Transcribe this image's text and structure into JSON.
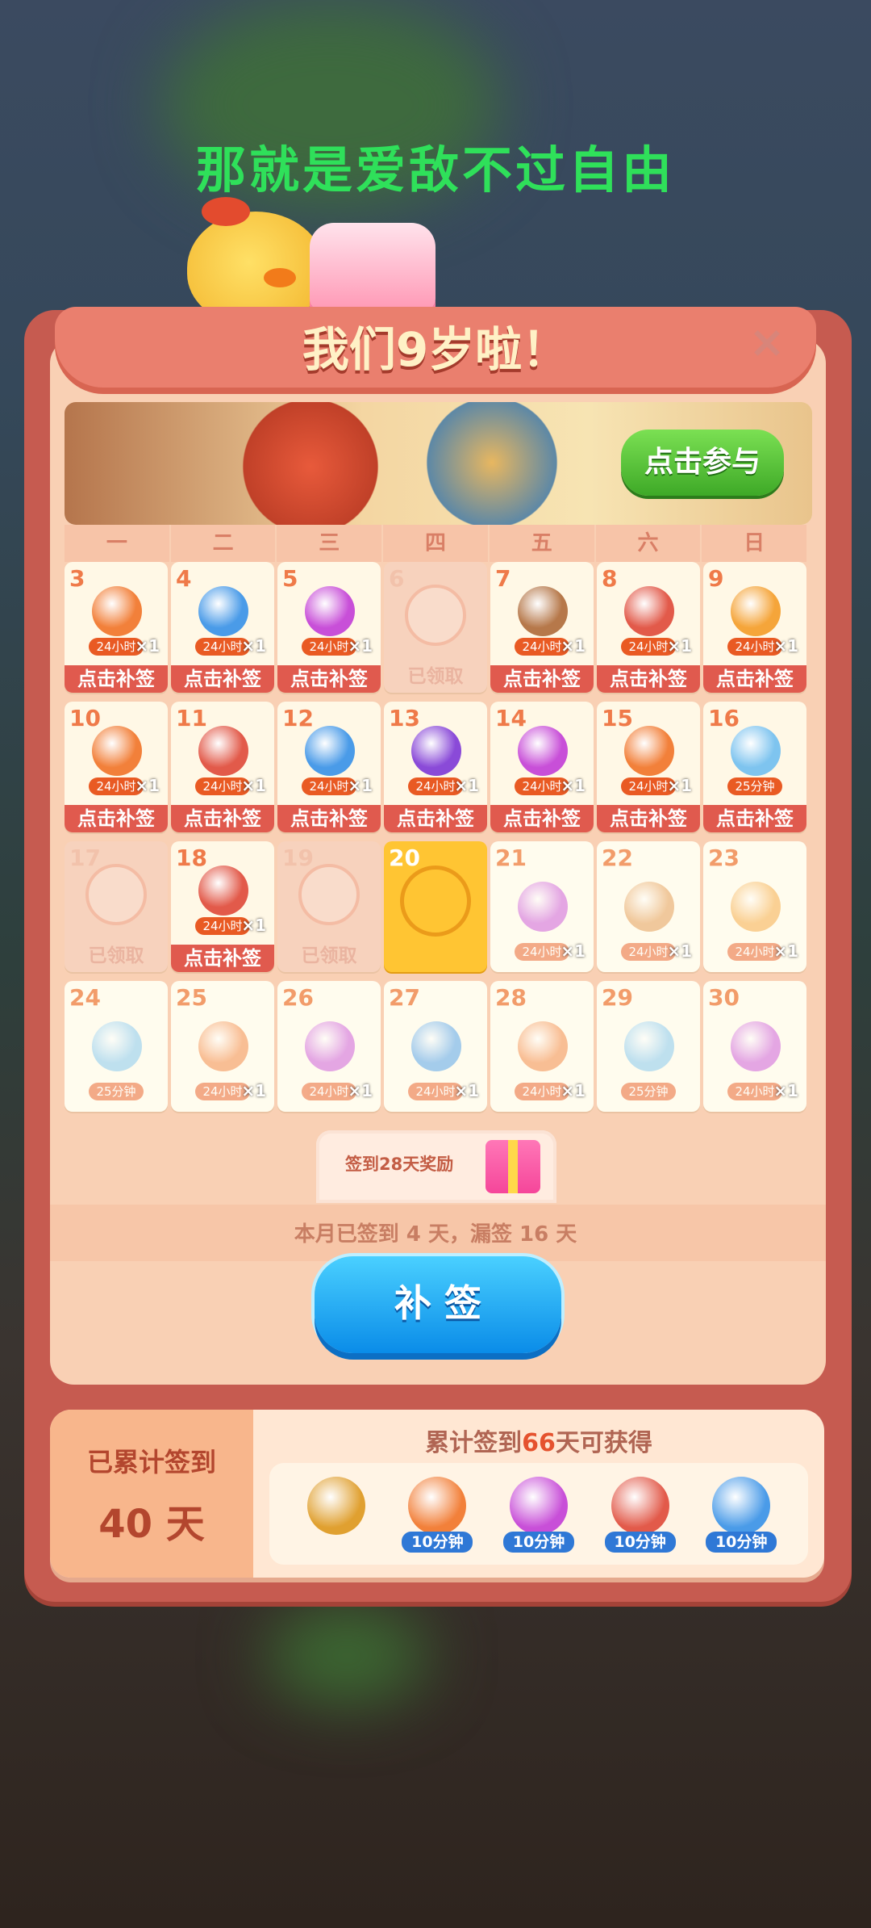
{
  "caption": "那就是爱敌不过自由",
  "title": "我们9岁啦！",
  "close_icon": "×",
  "banner": {
    "join_label": "点击参与"
  },
  "weekdays": [
    "一",
    "二",
    "三",
    "四",
    "五",
    "六",
    "日"
  ],
  "days": [
    {
      "n": "3",
      "icon": "plus3-icon",
      "tag": "24小时",
      "qty": "×1",
      "foot": "点击补签",
      "state": "missed",
      "color": "#f2803a"
    },
    {
      "n": "4",
      "icon": "blue-bird-icon",
      "tag": "24小时",
      "qty": "×1",
      "foot": "点击补签",
      "state": "missed",
      "color": "#4a9be8"
    },
    {
      "n": "5",
      "icon": "rainbow-owl-icon",
      "tag": "24小时",
      "qty": "×1",
      "foot": "点击补签",
      "state": "missed",
      "color": "#c84fd8"
    },
    {
      "n": "6",
      "icon": "paw-icon",
      "foot": "已领取",
      "state": "claimed"
    },
    {
      "n": "7",
      "icon": "hammer-icon",
      "tag": "24小时",
      "qty": "×1",
      "foot": "点击补签",
      "state": "missed",
      "color": "#b6784a"
    },
    {
      "n": "8",
      "icon": "rocket-icon",
      "tag": "24小时",
      "qty": "×1",
      "foot": "点击补签",
      "state": "missed",
      "color": "#e25a4a"
    },
    {
      "n": "9",
      "icon": "clock-icon",
      "tag": "24小时",
      "qty": "×1",
      "foot": "点击补签",
      "state": "missed",
      "color": "#f5a53a"
    },
    {
      "n": "10",
      "icon": "plus3-icon",
      "tag": "24小时",
      "qty": "×1",
      "foot": "点击补签",
      "state": "missed",
      "color": "#f2803a"
    },
    {
      "n": "11",
      "icon": "rocket-icon",
      "tag": "24小时",
      "qty": "×1",
      "foot": "点击补签",
      "state": "missed",
      "color": "#e25a4a"
    },
    {
      "n": "12",
      "icon": "blue-bird-icon",
      "tag": "24小时",
      "qty": "×1",
      "foot": "点击补签",
      "state": "missed",
      "color": "#4a9be8"
    },
    {
      "n": "13",
      "icon": "purple-bird-icon",
      "tag": "24小时",
      "qty": "×1",
      "foot": "点击补签",
      "state": "missed",
      "color": "#8a4ad8"
    },
    {
      "n": "14",
      "icon": "rainbow-owl-icon",
      "tag": "24小时",
      "qty": "×1",
      "foot": "点击补签",
      "state": "missed",
      "color": "#c84fd8"
    },
    {
      "n": "15",
      "icon": "plus3-icon",
      "tag": "24小时",
      "qty": "×1",
      "foot": "点击补签",
      "state": "missed",
      "color": "#f2803a"
    },
    {
      "n": "16",
      "icon": "bottle-icon",
      "tag": "25分钟",
      "qty": "",
      "foot": "点击补签",
      "state": "missed",
      "color": "#7ec4ef"
    },
    {
      "n": "17",
      "icon": "paw-icon",
      "foot": "已领取",
      "state": "claimed"
    },
    {
      "n": "18",
      "icon": "rocket-icon",
      "tag": "24小时",
      "qty": "×1",
      "foot": "点击补签",
      "state": "missed",
      "color": "#e25a4a"
    },
    {
      "n": "19",
      "icon": "paw-icon",
      "foot": "已领取",
      "state": "claimed"
    },
    {
      "n": "20",
      "icon": "paw-icon",
      "state": "today"
    },
    {
      "n": "21",
      "icon": "rainbow-owl-icon",
      "tag": "24小时",
      "qty": "×1",
      "state": "future",
      "color": "#c84fd8"
    },
    {
      "n": "22",
      "icon": "color-block-icon",
      "tag": "24小时",
      "qty": "×1",
      "state": "future",
      "color": "#e2954a"
    },
    {
      "n": "23",
      "icon": "clock-icon",
      "tag": "24小时",
      "qty": "×1",
      "state": "future",
      "color": "#f5a53a"
    },
    {
      "n": "24",
      "icon": "bottle-icon",
      "tag": "25分钟",
      "qty": "",
      "state": "future",
      "color": "#7ec4ef"
    },
    {
      "n": "25",
      "icon": "plus3-icon",
      "tag": "24小时",
      "qty": "×1",
      "state": "future",
      "color": "#f2803a"
    },
    {
      "n": "26",
      "icon": "rainbow-owl-icon",
      "tag": "24小时",
      "qty": "×1",
      "state": "future",
      "color": "#c84fd8"
    },
    {
      "n": "27",
      "icon": "blue-bird-icon",
      "tag": "24小时",
      "qty": "×1",
      "state": "future",
      "color": "#4a9be8"
    },
    {
      "n": "28",
      "icon": "plus3-icon",
      "tag": "24小时",
      "qty": "×1",
      "state": "future",
      "color": "#f2803a"
    },
    {
      "n": "29",
      "icon": "bottle-icon",
      "tag": "25分钟",
      "qty": "",
      "state": "future",
      "color": "#7ec4ef"
    },
    {
      "n": "30",
      "icon": "rainbow-owl-icon",
      "tag": "24小时",
      "qty": "×1",
      "state": "future",
      "color": "#c84fd8"
    }
  ],
  "reward28": "签到28天奖励",
  "progress": "本月已签到 4 天，漏签 16 天",
  "makeup_button": "补 签",
  "cumulative": {
    "left_label": "已累计签到",
    "left_value": "40 天",
    "title_prefix": "累计签到",
    "title_days": "66",
    "title_suffix": "天可获得",
    "rewards": [
      {
        "icon": "mystery-medal-icon",
        "label": "",
        "color": "#e0a030"
      },
      {
        "icon": "plus3-icon",
        "label": "10分钟",
        "color": "#f2803a"
      },
      {
        "icon": "rainbow-owl-icon",
        "label": "10分钟",
        "color": "#c84fd8"
      },
      {
        "icon": "rocket-icon",
        "label": "10分钟",
        "color": "#e25a4a"
      },
      {
        "icon": "blue-bird-icon",
        "label": "10分钟",
        "color": "#4a9be8"
      }
    ]
  }
}
